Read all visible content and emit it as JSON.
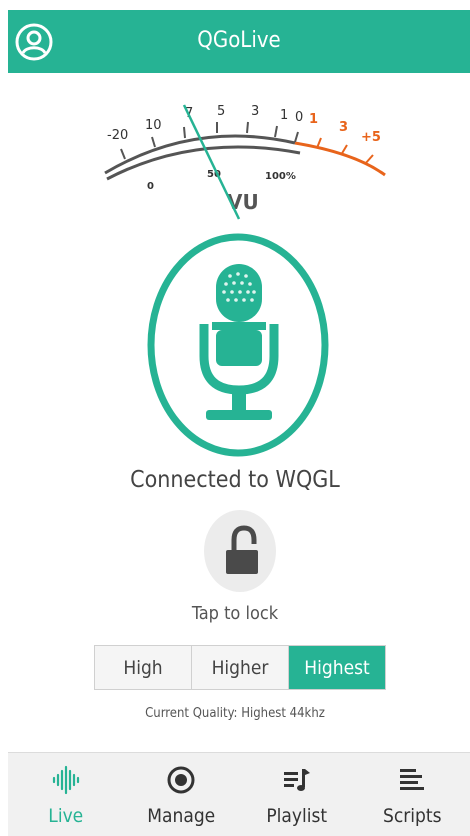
{
  "header": {
    "title": "QGoLive"
  },
  "vu_meter": {
    "top_scale": [
      "-20",
      "10",
      "7",
      "5",
      "3",
      "1",
      "0",
      "1",
      "3",
      "+5"
    ],
    "bottom_scale": [
      "0",
      "50",
      "100%"
    ],
    "unit_label": "VU",
    "needle_value": "7"
  },
  "status": {
    "text": "Connected to WQGL"
  },
  "lock": {
    "label": "Tap to lock"
  },
  "quality": {
    "options": [
      "High",
      "Higher",
      "Highest"
    ],
    "selected": "Highest",
    "current_text": "Current Quality: Highest 44khz"
  },
  "nav": {
    "items": [
      {
        "label": "Live",
        "icon": "waveform-icon",
        "active": true
      },
      {
        "label": "Manage",
        "icon": "record-icon",
        "active": false
      },
      {
        "label": "Playlist",
        "icon": "playlist-icon",
        "active": false
      },
      {
        "label": "Scripts",
        "icon": "scripts-icon",
        "active": false
      }
    ]
  },
  "colors": {
    "accent": "#26b394",
    "meter_red": "#e8641b",
    "meter_dark": "#555555"
  }
}
